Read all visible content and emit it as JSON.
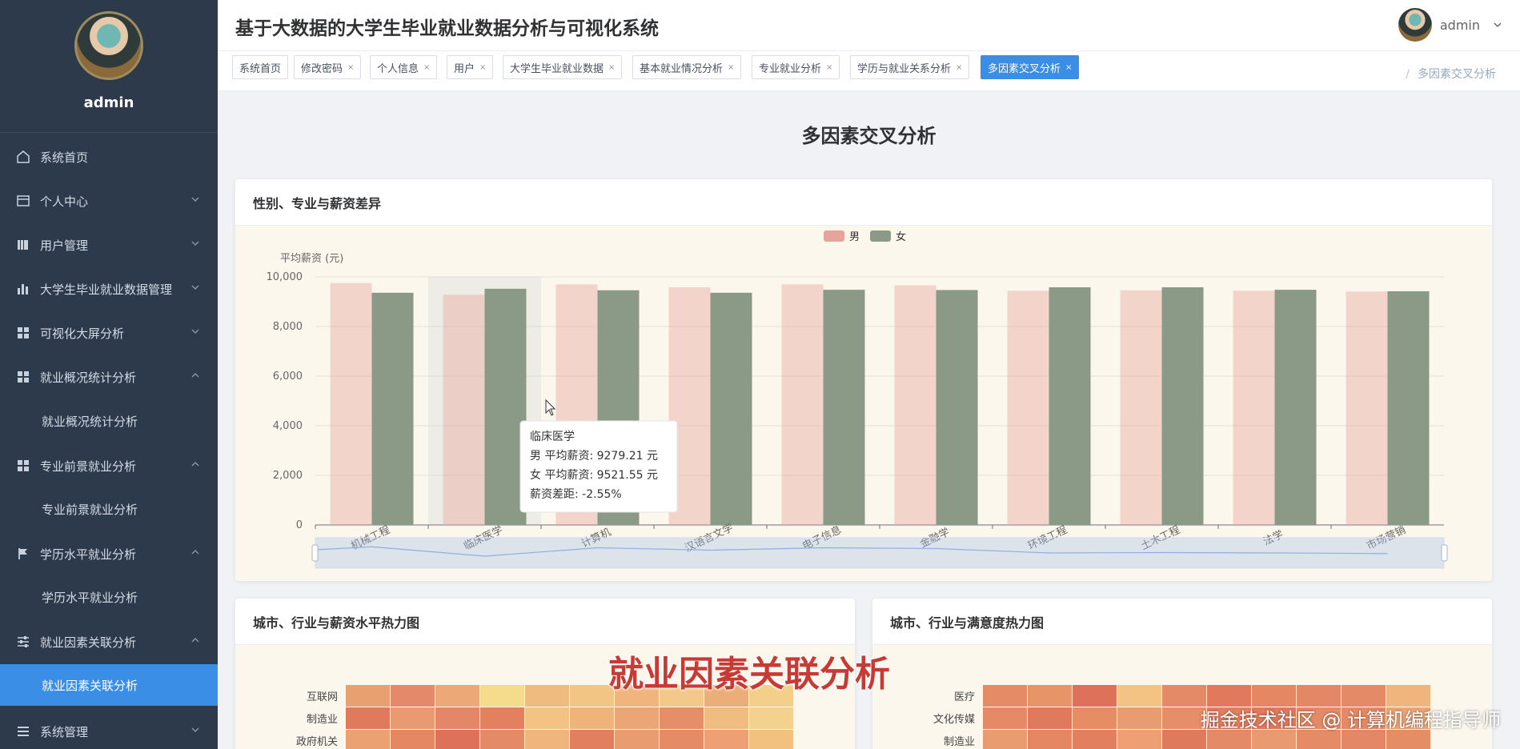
{
  "sidebar": {
    "username": "admin",
    "items": [
      {
        "label": "系统首页"
      },
      {
        "label": "个人中心"
      },
      {
        "label": "用户管理"
      },
      {
        "label": "大学生毕业就业数据管理"
      },
      {
        "label": "可视化大屏分析"
      },
      {
        "label": "就业概况统计分析"
      },
      {
        "label": "就业概况统计分析"
      },
      {
        "label": "专业前景就业分析"
      },
      {
        "label": "专业前景就业分析"
      },
      {
        "label": "学历水平就业分析"
      },
      {
        "label": "学历水平就业分析"
      },
      {
        "label": "就业因素关联分析"
      },
      {
        "label": "就业因素关联分析"
      },
      {
        "label": "系统管理"
      }
    ]
  },
  "header": {
    "title": "基于大数据的大学生毕业就业数据分析与可视化系统",
    "username": "admin"
  },
  "tags": [
    {
      "label": "系统首页",
      "close": ""
    },
    {
      "label": "修改密码",
      "close": "×"
    },
    {
      "label": "个人信息",
      "close": "×"
    },
    {
      "label": "用户",
      "close": "×"
    },
    {
      "label": "大学生毕业就业数据",
      "close": "×"
    },
    {
      "label": "基本就业情况分析",
      "close": "×"
    },
    {
      "label": "专业就业分析",
      "close": "×"
    },
    {
      "label": "学历与就业关系分析",
      "close": "×"
    },
    {
      "label": "多因素交叉分析",
      "close": "×"
    }
  ],
  "breadcrumb": {
    "separator": "/",
    "current": "多因素交叉分析"
  },
  "page_title": "多因素交叉分析",
  "cards": {
    "salary": {
      "title": "性别、专业与薪资差异"
    },
    "heat_salary": {
      "title": "城市、行业与薪资水平热力图"
    },
    "heat_satisfaction": {
      "title": "城市、行业与满意度热力图"
    }
  },
  "chart_data": [
    {
      "type": "bar",
      "ylabel": "平均薪资 (元)",
      "ylim": [
        0,
        10000
      ],
      "yticks": [
        "0",
        "2,000",
        "4,000",
        "6,000",
        "8,000",
        "10,000"
      ],
      "categories": [
        "机械工程",
        "临床医学",
        "计算机",
        "汉语言文学",
        "电子信息",
        "金融学",
        "环境工程",
        "土木工程",
        "法学",
        "市场营销"
      ],
      "series": [
        {
          "name": "男",
          "color": "#e8a49c",
          "values": [
            9750,
            9279.21,
            9700,
            9580,
            9700,
            9660,
            9440,
            9460,
            9440,
            9410
          ]
        },
        {
          "name": "女",
          "color": "#8b9a87",
          "values": [
            9360,
            9521.55,
            9460,
            9360,
            9480,
            9470,
            9580,
            9580,
            9480,
            9420
          ]
        }
      ],
      "legend_position": "top-center",
      "grid": true,
      "tooltip": {
        "category": "临床医学",
        "line1": "男 平均薪资: 9279.21 元",
        "line2": "女 平均薪资: 9521.55 元",
        "line3": "薪资差距: -2.55%"
      }
    },
    {
      "type": "heatmap",
      "row_labels": [
        "互联网",
        "制造业",
        "政府机关"
      ],
      "colors": [
        [
          "#e8a070",
          "#e48a6a",
          "#eda878",
          "#f5dc8c",
          "#f0bb7e",
          "#f2c585",
          "#f0b57c",
          "#f3c98a",
          "#ecae78",
          "#f3cf8a"
        ],
        [
          "#e07a5c",
          "#e99a70",
          "#e48768",
          "#e2805f",
          "#f2c383",
          "#f0b47b",
          "#eca676",
          "#e68e68",
          "#f1bc80",
          "#f4d18c"
        ],
        [
          "#eca173",
          "#e58762",
          "#de7159",
          "#e48a66",
          "#f0b57c",
          "#e27f5f",
          "#e99c70",
          "#e58b66",
          "#ef9f74",
          "#f2c17f"
        ]
      ]
    },
    {
      "type": "heatmap",
      "row_labels": [
        "医疗",
        "文化传媒",
        "制造业"
      ],
      "colors": [
        [
          "#e58b66",
          "#e79468",
          "#de7159",
          "#f2c383",
          "#e48a66",
          "#e17a5c",
          "#e58762",
          "#e48767",
          "#e48a66",
          "#f0b57c"
        ],
        [
          "#e48a66",
          "#e07a5c",
          "#e58e66",
          "#e99c70",
          "#e68e68",
          "#e27f5f",
          "#e07a5c",
          "#e58a66",
          "#e48a66",
          "#eca676"
        ],
        [
          "#e99c70",
          "#e58762",
          "#e27f5f",
          "#ef9f74",
          "#e07a5c",
          "#e48a66",
          "#e99a70",
          "#e58b66",
          "#e48767",
          "#e58e66"
        ]
      ]
    }
  ],
  "overlay_caption": "就业因素关联分析",
  "watermark": "掘金技术社区 @ 计算机编程指导师"
}
